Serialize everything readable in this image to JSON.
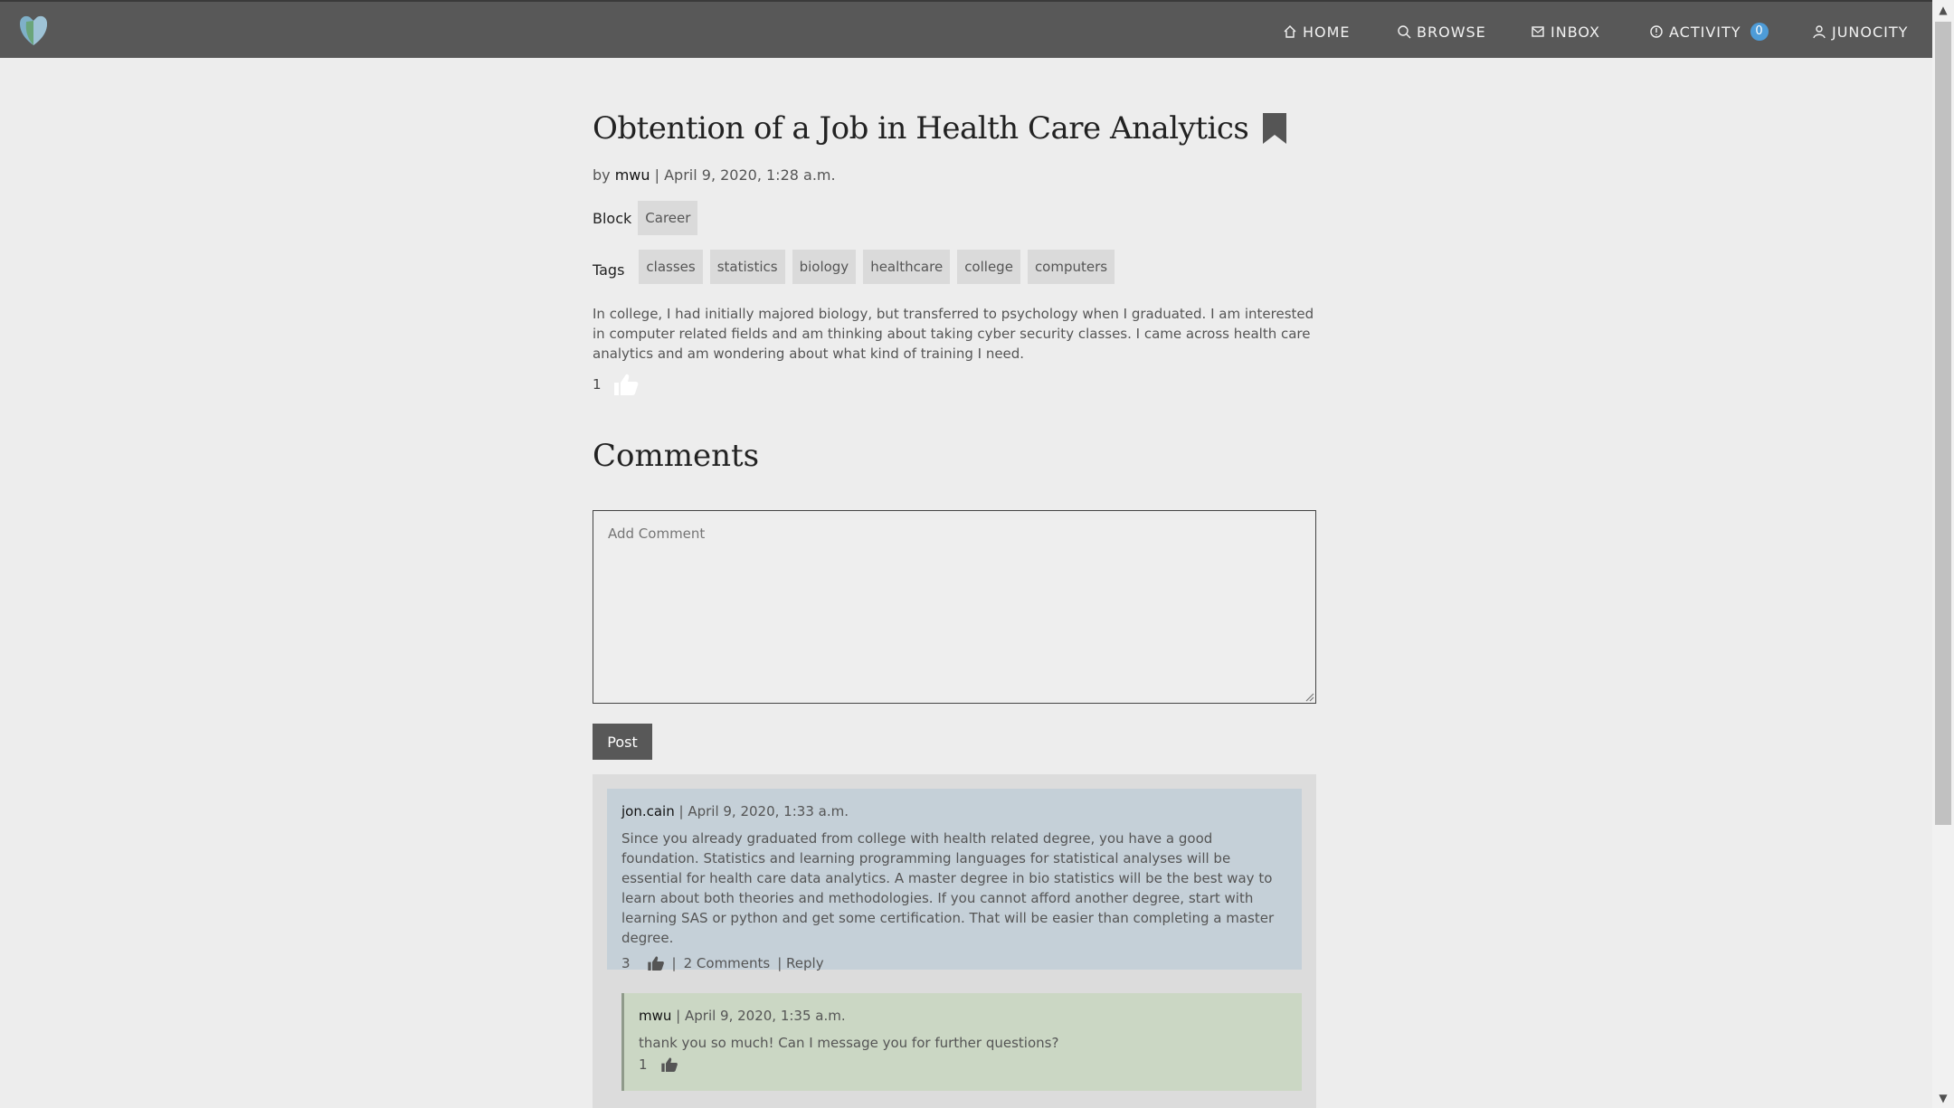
{
  "nav": {
    "items": [
      {
        "label": "HOME",
        "icon": "home-icon"
      },
      {
        "label": "BROWSE",
        "icon": "search-icon"
      },
      {
        "label": "INBOX",
        "icon": "inbox-icon"
      },
      {
        "label": "ACTIVITY",
        "icon": "activity-icon",
        "badge": "0"
      },
      {
        "label": "JUNOCITY",
        "icon": "user-icon"
      }
    ]
  },
  "post": {
    "title": "Obtention of a Job in Health Care Analytics",
    "by_prefix": "by",
    "author": "mwu",
    "date": "| April 9, 2020, 1:28 a.m.",
    "block_label": "Block",
    "block": "Career",
    "tags_label": "Tags",
    "tags": [
      "classes",
      "statistics",
      "biology",
      "healthcare",
      "college",
      "computers"
    ],
    "body": "In college, I had initially majored biology, but transferred to psychology when I graduated. I am interested in computer related fields and am thinking about taking cyber security classes. I came across health care analytics and am wondering about what kind of training I need.",
    "likes": "1"
  },
  "comments": {
    "title": "Comments",
    "placeholder": "Add Comment",
    "post_button": "Post",
    "items": [
      {
        "author": "jon.cain",
        "date": "| April 9, 2020, 1:33 a.m.",
        "text": "Since you already graduated from college with health related degree, you have a good foundation. Statistics and learning programming languages for statistical analyses will be essential for health care data analytics. A master degree in bio statistics will be the best way to learn about both theories and methodologies. If you cannot afford another degree, start with learning SAS or python and get some certification. That will be easier than completing a master degree.",
        "likes": "3",
        "separator": "|",
        "comments_link": "2 Comments",
        "reply_link": "| Reply"
      }
    ],
    "replies": [
      {
        "author": "mwu",
        "date": "| April 9, 2020, 1:35 a.m.",
        "text": "thank you so much! Can I message you for further questions?",
        "likes": "1"
      }
    ]
  },
  "colors": {
    "navbar": "#585858",
    "accent_badge": "#4e9cd8",
    "comment_bg": "#c5d0d8",
    "reply_bg": "#cbd7c4"
  }
}
